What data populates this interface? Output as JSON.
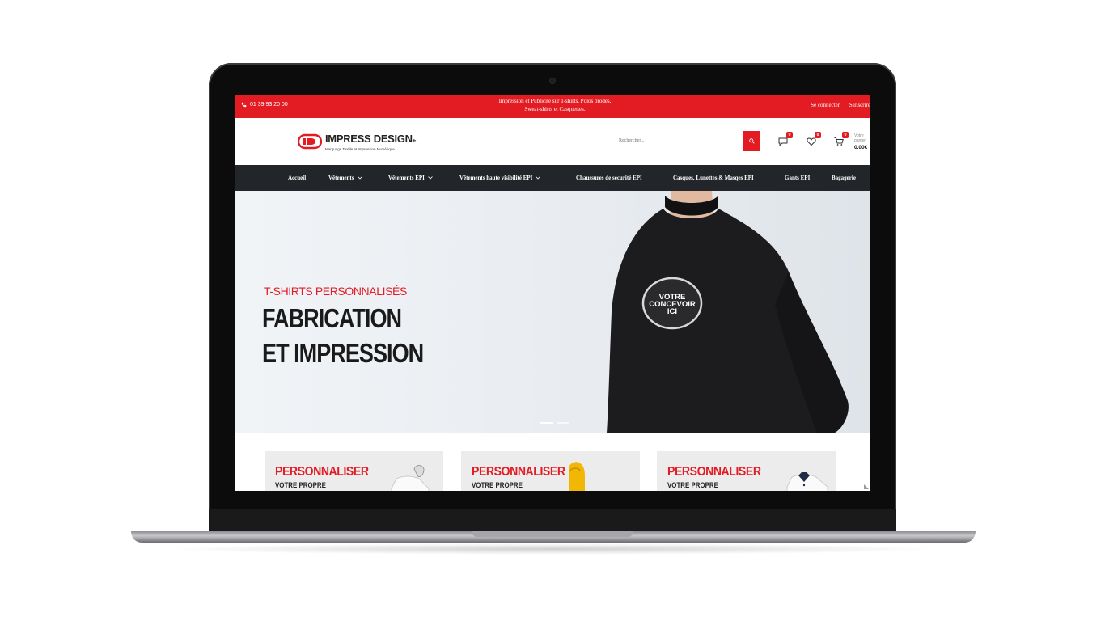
{
  "topbar": {
    "phone": "01 39 93 20 00",
    "promo_line1": "Impression et Publicité sur T-shirts, Polos brodés,",
    "promo_line2": "Sweat-shirts et Casquettes.",
    "login": "Se connecter",
    "register": "S'inscrire"
  },
  "header": {
    "logo_title": "IMPRESS DESIGN",
    "logo_suffix": ".fr",
    "logo_tagline": "Marquage Textile et Impression Numérique",
    "search_placeholder": "Rechercher...",
    "compare_count": "0",
    "wishlist_count": "0",
    "cart_count": "0",
    "cart_label_1": "Votre",
    "cart_label_2": "panier",
    "cart_total": "0.00€"
  },
  "nav": {
    "items": [
      {
        "label": "Accueil"
      },
      {
        "label": "Vêtements"
      },
      {
        "label": "Vêtements EPI"
      },
      {
        "label": "Vêtements haute visibilité EPI"
      },
      {
        "label": "Chaussures de securité EPI"
      },
      {
        "label": "Casques, Lunettes & Masqes EPI"
      },
      {
        "label": "Gants EPI"
      },
      {
        "label": "Bagagerie"
      }
    ]
  },
  "hero": {
    "kicker": "T-SHIRTS PERSONNALISÉS",
    "title_line1": "FABRICATION",
    "title_line2": "ET IMPRESSION",
    "stamp_line1": "VOTRE",
    "stamp_line2": "CONCEVOIR",
    "stamp_line3": "ICI"
  },
  "cards": [
    {
      "title": "PERSONNALISER",
      "subtitle": "VOTRE PROPRE"
    },
    {
      "title": "PERSONNALISER",
      "subtitle": "VOTRE PROPRE"
    },
    {
      "title": "PERSONNALISER",
      "subtitle": "VOTRE PROPRE"
    }
  ],
  "colors": {
    "brand_red": "#e31b23",
    "nav_dark": "#22262a"
  }
}
